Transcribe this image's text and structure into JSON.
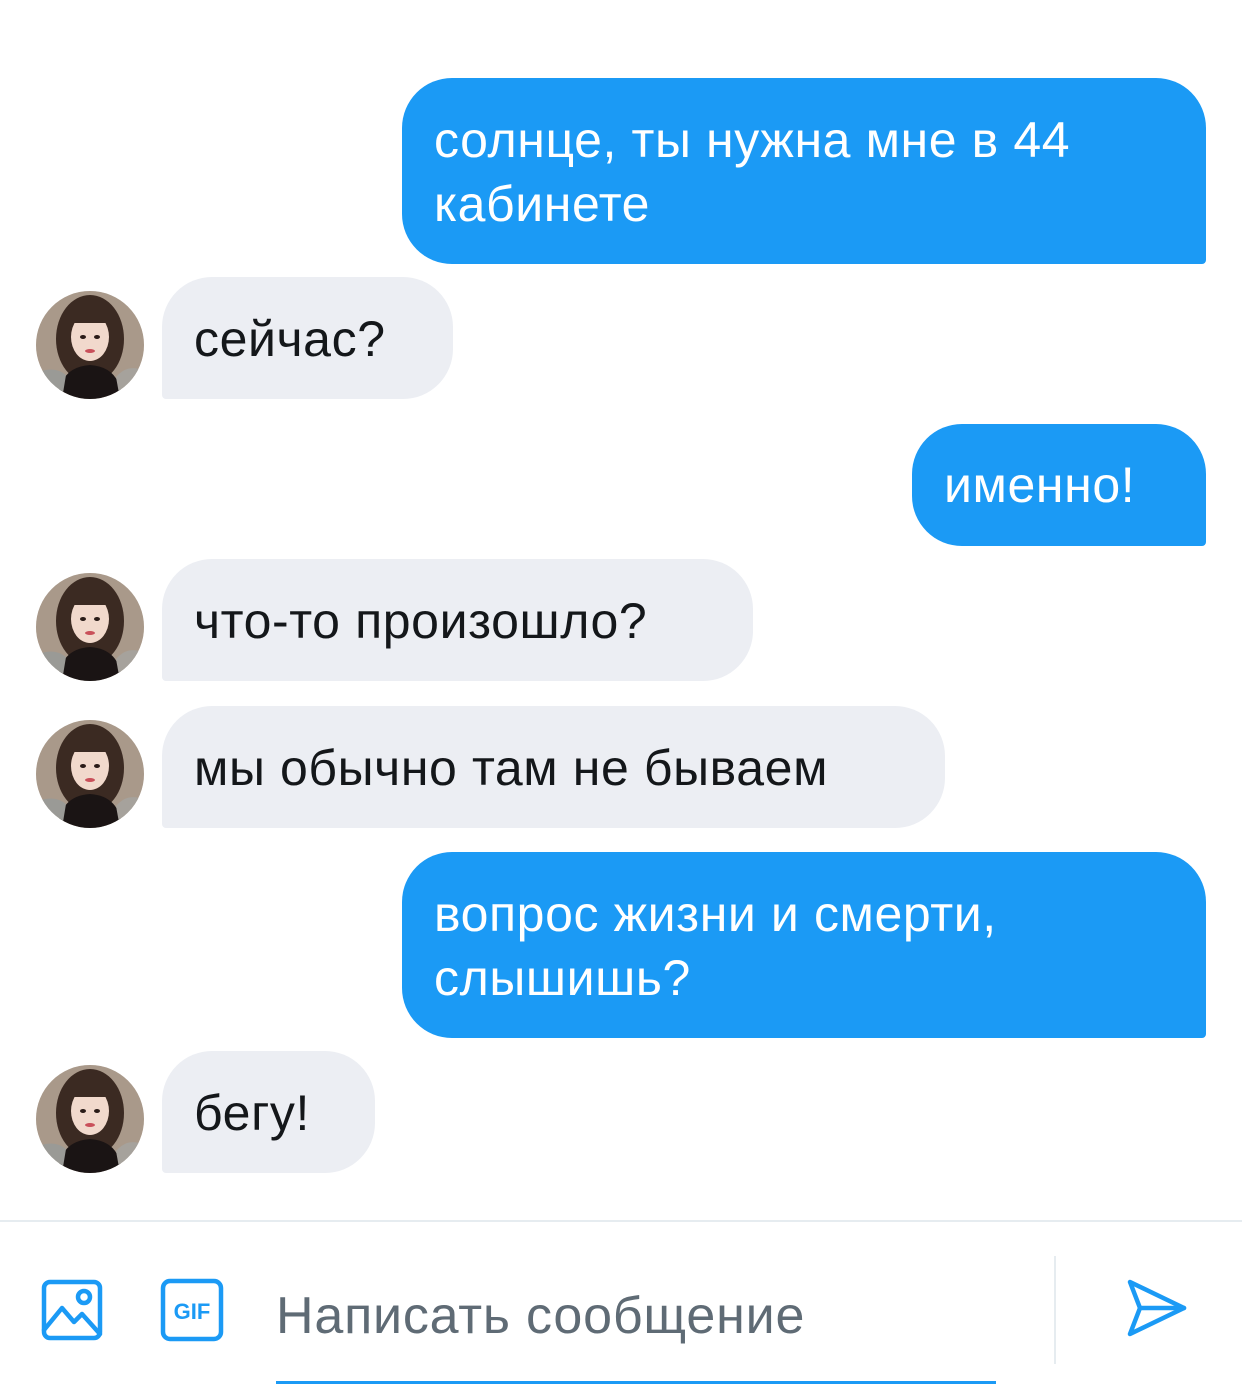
{
  "messages": [
    {
      "direction": "outgoing",
      "lines": [
        "солнце, ты нужна мне в 44",
        "кабинете"
      ]
    },
    {
      "direction": "incoming",
      "lines": [
        "сейчас?"
      ]
    },
    {
      "direction": "outgoing",
      "lines": [
        "именно!"
      ]
    },
    {
      "direction": "incoming",
      "lines": [
        "что-то произошло?"
      ]
    },
    {
      "direction": "incoming",
      "lines": [
        "мы обычно там не бываем"
      ]
    },
    {
      "direction": "outgoing",
      "lines": [
        "вопрос жизни и смерти,",
        "слышишь?"
      ]
    },
    {
      "direction": "incoming",
      "lines": [
        "бегу!"
      ]
    }
  ],
  "composer": {
    "placeholder": "Написать сообщение",
    "gif_label": "GIF",
    "image_icon": "image-icon",
    "gif_icon": "gif-icon",
    "send_icon": "send-icon"
  },
  "colors": {
    "accent": "#1b9af5",
    "incoming_bubble": "#eceef3",
    "incoming_text": "#14171a",
    "outgoing_text": "#ffffff",
    "placeholder": "#5f6b75"
  }
}
